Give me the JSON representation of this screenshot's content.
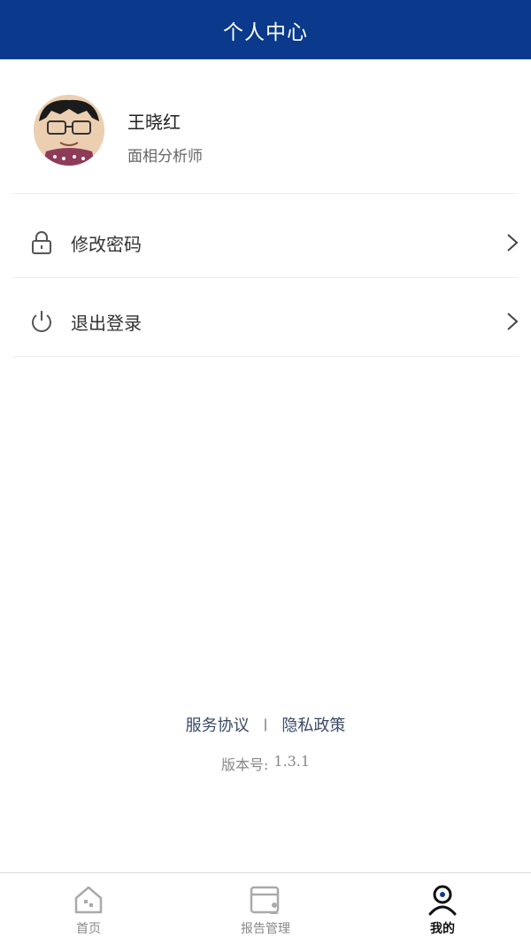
{
  "header": {
    "title": "个人中心"
  },
  "profile": {
    "name": "王晓红",
    "role": "面相分析师"
  },
  "menu": [
    {
      "label": "修改密码",
      "icon": "lock-icon"
    },
    {
      "label": "退出登录",
      "icon": "power-icon"
    }
  ],
  "footer": {
    "service_agreement": "服务协议",
    "separator": "|",
    "privacy_policy": "隐私政策",
    "version_label": "版本号:",
    "version_value": "1.3.1"
  },
  "tabs": [
    {
      "label": "首页",
      "icon": "home-icon",
      "active": false
    },
    {
      "label": "报告管理",
      "icon": "report-icon",
      "active": false
    },
    {
      "label": "我的",
      "icon": "profile-icon",
      "active": true
    }
  ],
  "colors": {
    "brand": "#0b3a8c",
    "text_muted": "#888888"
  }
}
